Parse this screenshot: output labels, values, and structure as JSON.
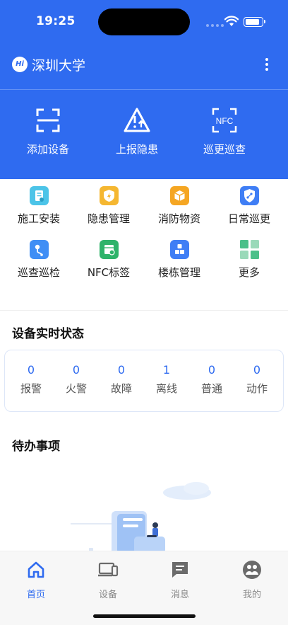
{
  "status_bar": {
    "time": "19:25",
    "battery_level": 0.9
  },
  "header": {
    "logo_text": "Hi",
    "title": "深圳大学"
  },
  "quick_actions": [
    {
      "label": "添加设备",
      "icon": "scan-icon"
    },
    {
      "label": "上报隐患",
      "icon": "warning-report-icon"
    },
    {
      "label": "巡更巡查",
      "icon": "nfc-icon",
      "icon_text": "NFC"
    }
  ],
  "functions": [
    {
      "label": "施工安装",
      "icon": "construction-icon",
      "color": "#4cc4e8"
    },
    {
      "label": "隐患管理",
      "icon": "hazard-icon",
      "color": "#f5b731"
    },
    {
      "label": "消防物资",
      "icon": "supplies-icon",
      "color": "#f5a623"
    },
    {
      "label": "日常巡更",
      "icon": "patrol-shield-icon",
      "color": "#3f7ef5"
    },
    {
      "label": "巡查巡检",
      "icon": "route-map-icon",
      "color": "#3f8ef5"
    },
    {
      "label": "NFC标签",
      "icon": "tag-calendar-icon",
      "color": "#2fb36a"
    },
    {
      "label": "楼栋管理",
      "icon": "building-blocks-icon",
      "color": "#3f7ef5"
    },
    {
      "label": "更多",
      "icon": "grid-more-icon",
      "color": "#4cc08a"
    }
  ],
  "device_status": {
    "title": "设备实时状态",
    "stats": [
      {
        "value": "0",
        "label": "报警"
      },
      {
        "value": "0",
        "label": "火警"
      },
      {
        "value": "0",
        "label": "故障"
      },
      {
        "value": "1",
        "label": "离线"
      },
      {
        "value": "0",
        "label": "普通"
      },
      {
        "value": "0",
        "label": "动作"
      }
    ]
  },
  "todo": {
    "title": "待办事项"
  },
  "tabs": [
    {
      "label": "首页",
      "icon": "home-icon",
      "active": true
    },
    {
      "label": "设备",
      "icon": "devices-icon",
      "active": false
    },
    {
      "label": "消息",
      "icon": "message-icon",
      "active": false
    },
    {
      "label": "我的",
      "icon": "profile-icon",
      "active": false
    }
  ],
  "colors": {
    "brand": "#2f6bf0",
    "tab_inactive": "#888888"
  }
}
